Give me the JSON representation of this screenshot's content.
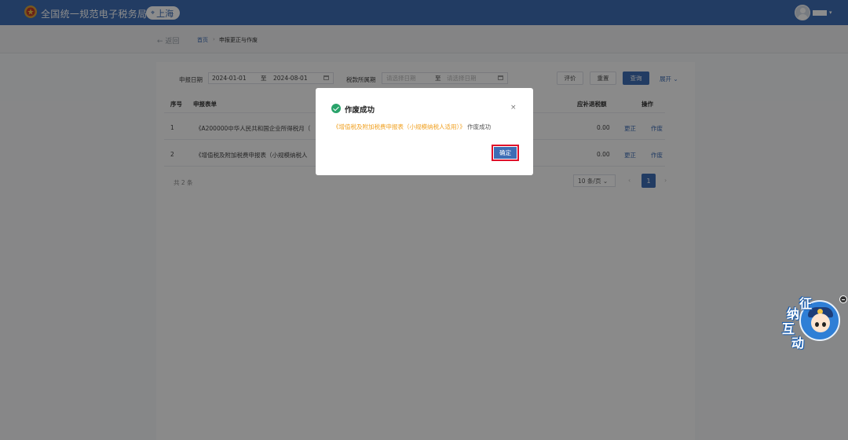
{
  "header": {
    "app_title": "全国统一规范电子税务局",
    "region": "上海",
    "colors": {
      "brand": "#3e6db5"
    }
  },
  "breadcrumb": {
    "back_label": "← 返回",
    "home": "首页",
    "separator": "›",
    "current": "申报更正与作废"
  },
  "filters": {
    "declare_date_label": "申报日期",
    "date_from": "2024-01-01",
    "to_label": "至",
    "date_to": "2024-08-01",
    "tax_period_label": "税款所属期",
    "period_from_placeholder": "请选择日期",
    "period_to_placeholder": "请选择日期",
    "buttons": {
      "evaluate": "评价",
      "reset": "重置",
      "query": "查询",
      "expand": "展开 ⌄"
    }
  },
  "table": {
    "columns": {
      "index": "序号",
      "form": "申报表单",
      "amount": "应补退税额",
      "actions": "操作"
    },
    "rows": [
      {
        "index": "1",
        "form": "《A200000中华人民共和国企业所得税月（",
        "amount": "0.00",
        "correct": "更正",
        "void": "作废"
      },
      {
        "index": "2",
        "form": "《增值税及附加税费申报表（小规模纳税人",
        "amount": "0.00",
        "correct": "更正",
        "void": "作废"
      }
    ],
    "total": "共 2 条",
    "page_size": "10 条/页 ⌄",
    "current_page": "1",
    "prev": "‹",
    "next": "›"
  },
  "modal": {
    "title": "作废成功",
    "close": "×",
    "message_highlight": "《增值税及附加税费申报表（小规模纳税人适用）》",
    "message_tail": "作废成功",
    "confirm_label": "确定",
    "colors": {
      "success": "#29a36a",
      "highlight": "#f0a020",
      "focus_border": "#e0102a"
    }
  },
  "assistant": {
    "chars": [
      "征",
      "纳",
      "互",
      "动"
    ]
  }
}
